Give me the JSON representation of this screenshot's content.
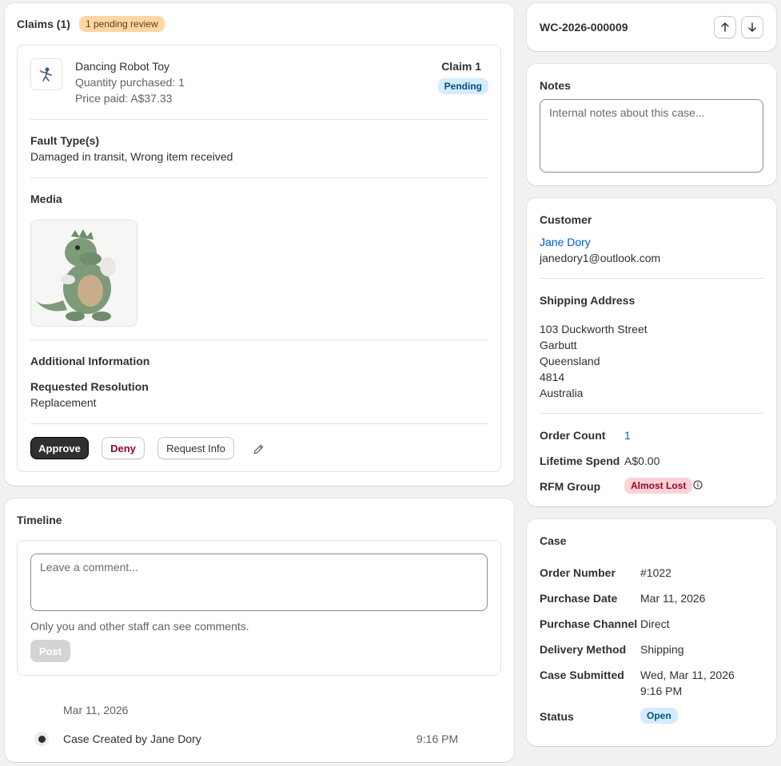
{
  "claims": {
    "title": "Claims (1)",
    "pending_badge": "1 pending review",
    "item": {
      "name": "Dancing Robot Toy",
      "quantity": "Quantity purchased: 1",
      "price": "Price paid: A$37.33",
      "claim_label": "Claim 1",
      "status": "Pending"
    },
    "fault_heading": "Fault Type(s)",
    "fault_value": "Damaged in transit, Wrong item received",
    "media_heading": "Media",
    "additional_heading": "Additional Information",
    "resolution_label": "Requested Resolution",
    "resolution_value": "Replacement",
    "actions": {
      "approve": "Approve",
      "deny": "Deny",
      "request_info": "Request Info"
    }
  },
  "timeline": {
    "title": "Timeline",
    "comment_placeholder": "Leave a comment...",
    "hint": "Only you and other staff can see comments.",
    "post": "Post",
    "date": "Mar 11, 2026",
    "event": "Case Created by Jane Dory",
    "event_time": "9:16 PM"
  },
  "header": {
    "case_id": "WC-2026-000009"
  },
  "notes": {
    "title": "Notes",
    "placeholder": "Internal notes about this case..."
  },
  "customer": {
    "title": "Customer",
    "name": "Jane Dory",
    "email": "janedory1@outlook.com",
    "shipping_title": "Shipping Address",
    "address": [
      "103 Duckworth Street",
      "Garbutt",
      "Queensland",
      "4814",
      "Australia"
    ],
    "order_count_label": "Order Count",
    "order_count": "1",
    "lifetime_label": "Lifetime Spend",
    "lifetime_value": "A$0.00",
    "rfm_label": "RFM Group",
    "rfm_value": "Almost Lost"
  },
  "case": {
    "title": "Case",
    "rows": [
      {
        "label": "Order Number",
        "value": "#1022"
      },
      {
        "label": "Purchase Date",
        "value": "Mar 11, 2026"
      },
      {
        "label": "Purchase Channel",
        "value": "Direct"
      },
      {
        "label": "Delivery Method",
        "value": "Shipping"
      },
      {
        "label": "Case Submitted",
        "value": "Wed, Mar 11, 2026",
        "value2": "9:16 PM"
      }
    ],
    "status_label": "Status",
    "status_value": "Open"
  },
  "colors": {
    "pending_badge_bg": "#ffd6a4",
    "pending_status_bg": "#d5ebff",
    "rfm_bg": "#fed1d7",
    "open_bg": "#d5ebff",
    "link": "#005bd3",
    "approve_bg": "#303030"
  },
  "icons": [
    "robot-thumbnail-icon",
    "pencil-icon",
    "arrow-up-icon",
    "arrow-down-icon",
    "info-icon",
    "timeline-dot-icon"
  ]
}
